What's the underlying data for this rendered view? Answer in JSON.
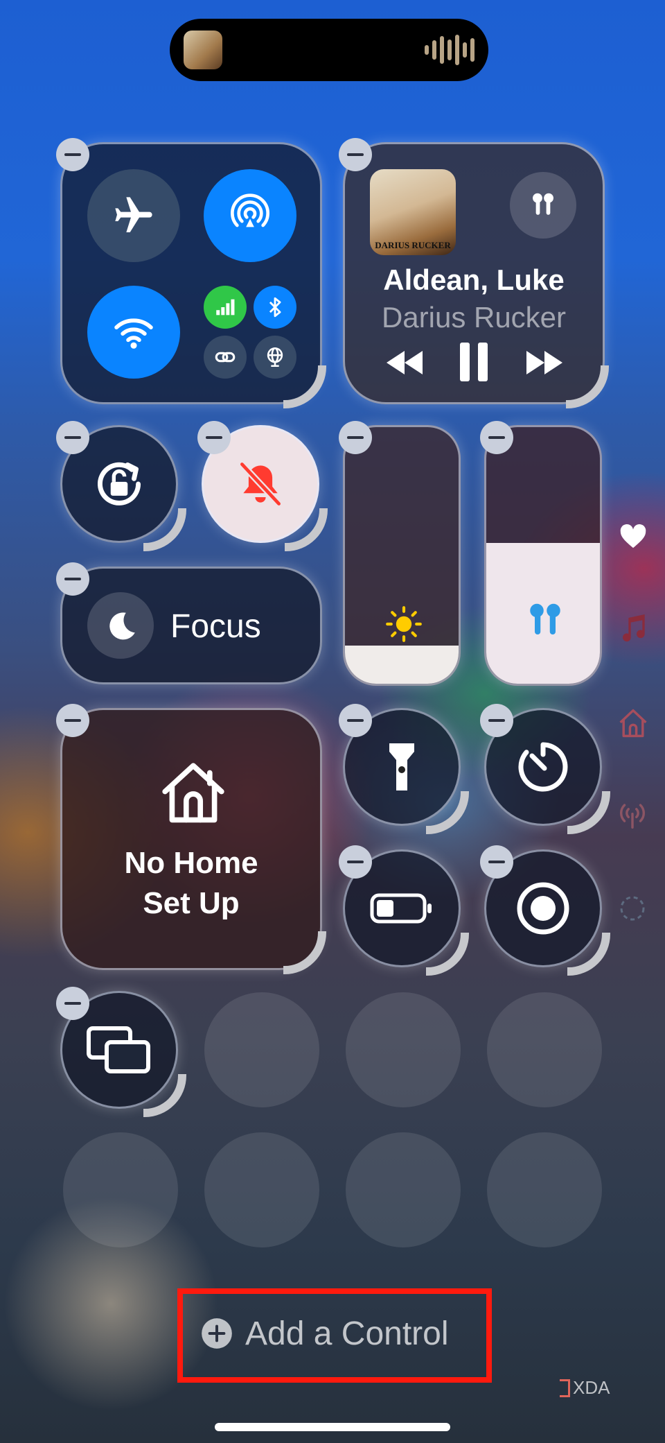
{
  "now_playing": {
    "song": "Aldean, Luke",
    "artist": "Darius Rucker",
    "album_text": "DARIUS RUCKER"
  },
  "focus": {
    "label": "Focus"
  },
  "home": {
    "line1": "No Home",
    "line2": "Set Up"
  },
  "add_control": {
    "label": "Add a Control"
  },
  "watermark": {
    "text": "XDA"
  },
  "levels": {
    "brightness": 0.15,
    "volume": 0.55
  },
  "side_icons": [
    "heart-icon",
    "music-note-icon",
    "home-icon",
    "antenna-icon",
    "dashed-circle-icon"
  ],
  "colors": {
    "accent": "#0a84ff",
    "cellular": "#30c748",
    "silent": "#ff3b30",
    "highlight_box": "#ff1a0e"
  }
}
